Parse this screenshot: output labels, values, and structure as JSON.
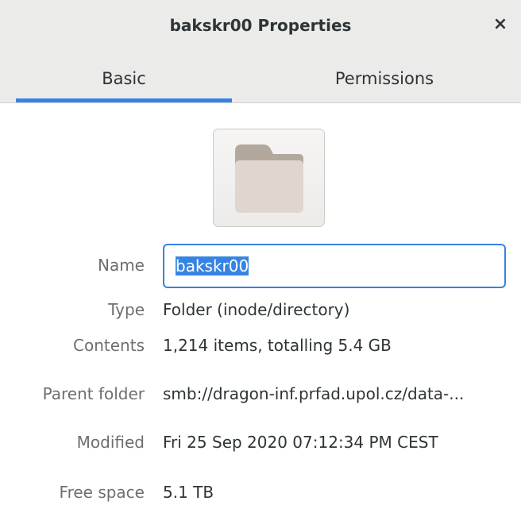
{
  "window": {
    "title": "bakskr00 Properties",
    "close_glyph": "×",
    "close_icon": "close-icon"
  },
  "tabs": [
    {
      "label": "Basic",
      "selected": true
    },
    {
      "label": "Permissions",
      "selected": false
    }
  ],
  "accent_color": "#3584e4",
  "folder_icon": "folder-icon",
  "properties": {
    "name_label": "Name",
    "name_value": "bakskr00",
    "type_label": "Type",
    "type_value": "Folder (inode/directory)",
    "contents_label": "Contents",
    "contents_value": "1,214 items, totalling 5.4 GB",
    "parent_label": "Parent folder",
    "parent_value": "smb://dragon-inf.prfad.upol.cz/data-...",
    "modified_label": "Modified",
    "modified_value": "Fri 25 Sep 2020 07:12:34 PM CEST",
    "free_label": "Free space",
    "free_value": "5.1 TB"
  }
}
